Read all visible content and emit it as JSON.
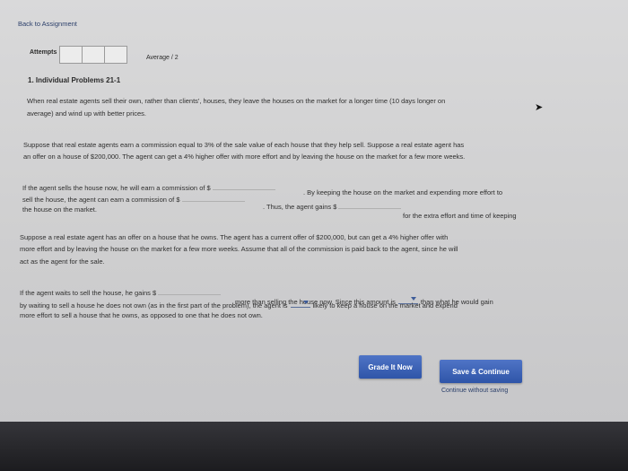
{
  "header": {
    "back_link": "Back to Assignment"
  },
  "meta": {
    "attempts_label": "Attempts",
    "average_label": "Average / 2"
  },
  "problem": {
    "title": "1. Individual Problems 21-1"
  },
  "intro": {
    "line1": "When real estate agents sell their own, rather than clients', houses, they leave the houses on the market for a longer time (10 days longer on",
    "line2": "average) and wind up with better prices."
  },
  "scenario1": {
    "line1": "Suppose that real estate agents earn a commission equal to 3% of the sale value of each house that they help sell. Suppose a real estate agent has",
    "line2": "an offer on a house of $200,000. The agent can get a 4% higher offer with more effort and by leaving the house on the market for a few more weeks."
  },
  "q1": {
    "a": "If the agent sells the house now, he will earn a commission of",
    "b": ". By keeping the house on the market and expending more effort to",
    "c": "sell the house, the agent can earn a commission of",
    "d": ". Thus, the agent gains",
    "e": "the house on the market.",
    "f": "for the extra effort and time of keeping",
    "currency": "$"
  },
  "scenario2": {
    "line1": "Suppose a real estate agent has an offer on a house that he owns. The agent has a current offer of $200,000, but can get a 4% higher offer with",
    "line2": "more effort and by leaving the house on the market for a few more weeks. Assume that all of the commission is paid back to the agent, since he will",
    "line3": "act as the agent for the sale."
  },
  "q2": {
    "a": "If the agent waits to sell the house, he gains",
    "b": "more than selling the house now. Since this amount is",
    "c": "than what he would gain",
    "d": "by waiting to sell a house he does not own (as in the first part of the problem), the agent is",
    "e": "likely to keep a house on the market and expend",
    "f": "more effort to sell a house that he owns, as opposed to one that he does not own.",
    "currency": "$"
  },
  "actions": {
    "grade_label": "Grade It Now",
    "save_label": "Save & Continue",
    "continue_link": "Continue without saving"
  }
}
